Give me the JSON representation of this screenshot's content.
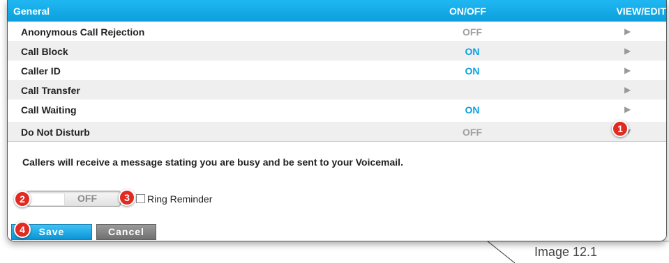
{
  "header": {
    "general": "General",
    "onoff": "ON/OFF",
    "viewedit": "VIEW/EDIT"
  },
  "rows": [
    {
      "label": "Anonymous Call Rejection",
      "state": "OFF"
    },
    {
      "label": "Call Block",
      "state": "ON"
    },
    {
      "label": "Caller ID",
      "state": "ON"
    },
    {
      "label": "Call Transfer",
      "state": ""
    },
    {
      "label": "Call Waiting",
      "state": "ON"
    },
    {
      "label": "Do Not Disturb",
      "state": "OFF"
    }
  ],
  "expanded": {
    "description": "Callers will receive a message stating you are busy and be sent to your Voicemail.",
    "toggle_state": "OFF",
    "ring_reminder_label": "Ring Reminder",
    "ring_reminder_checked": false,
    "save_label": "Save",
    "cancel_label": "Cancel"
  },
  "icons": {
    "collapsed": "arrow-right-icon",
    "expanded": "arrow-down-icon"
  },
  "badges": [
    "1",
    "2",
    "3",
    "4"
  ],
  "caption": "Image 12.1",
  "colors": {
    "header": "#0c9fdc",
    "on": "#0a9fe0",
    "off": "#a0a0a0",
    "badge": "#e02a22"
  }
}
